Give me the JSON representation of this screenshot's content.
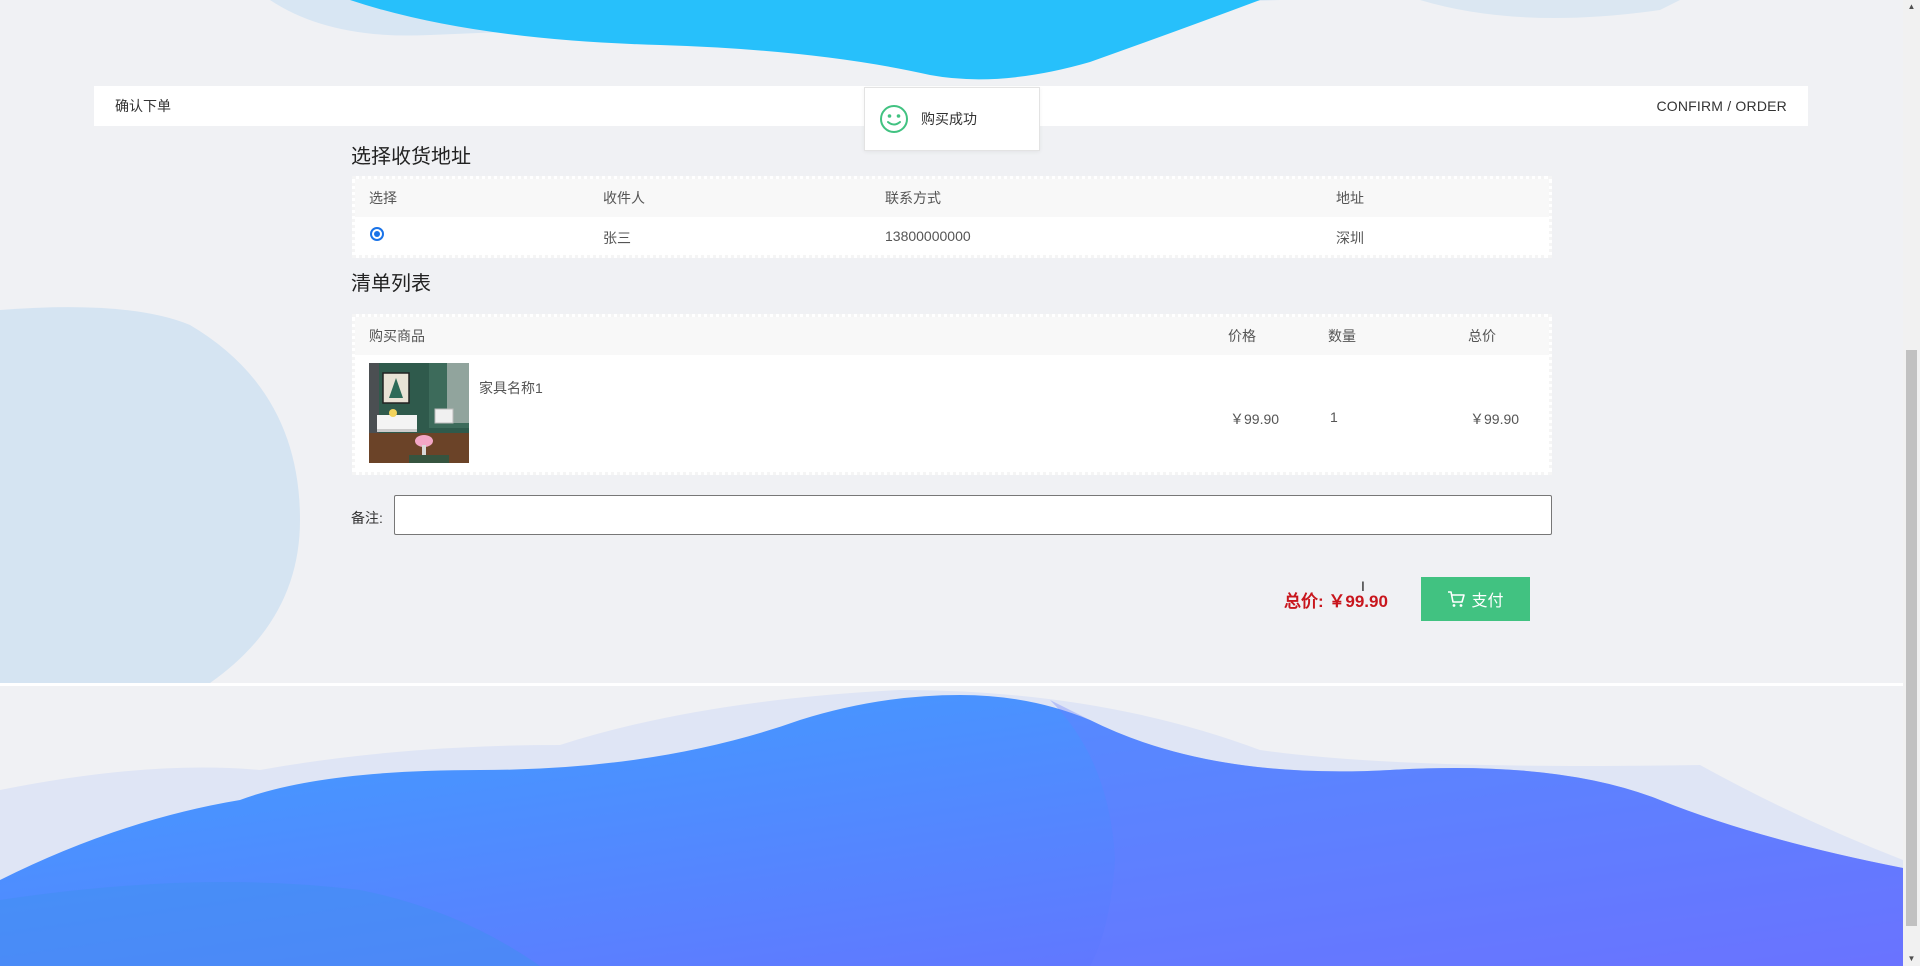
{
  "header": {
    "title": "确认下单",
    "subtitle_en": "CONFIRM / ORDER"
  },
  "toast": {
    "message": "购买成功",
    "icon": "smile-icon"
  },
  "address_section": {
    "title": "选择收货地址",
    "columns": [
      "选择",
      "收件人",
      "联系方式",
      "地址"
    ],
    "rows": [
      {
        "selected": true,
        "recipient": "张三",
        "phone": "13800000000",
        "address": "深圳"
      }
    ]
  },
  "list_section": {
    "title": "清单列表",
    "columns": [
      "购买商品",
      "价格",
      "数量",
      "总价"
    ],
    "items": [
      {
        "name": "家具名称1",
        "price": "￥99.90",
        "quantity": "1",
        "subtotal": "￥99.90"
      }
    ]
  },
  "note": {
    "label": "备注:",
    "value": ""
  },
  "total": {
    "label": "总价: ",
    "value": "￥99.90"
  },
  "pay_button": {
    "label": "支付",
    "icon": "cart-icon"
  },
  "colors": {
    "accent_green": "#41c281",
    "price_red": "#c8161d",
    "wave_top": "#27c0fb",
    "wave_bottom_start": "#3ea0ff",
    "wave_bottom_end": "#6a6dff"
  }
}
